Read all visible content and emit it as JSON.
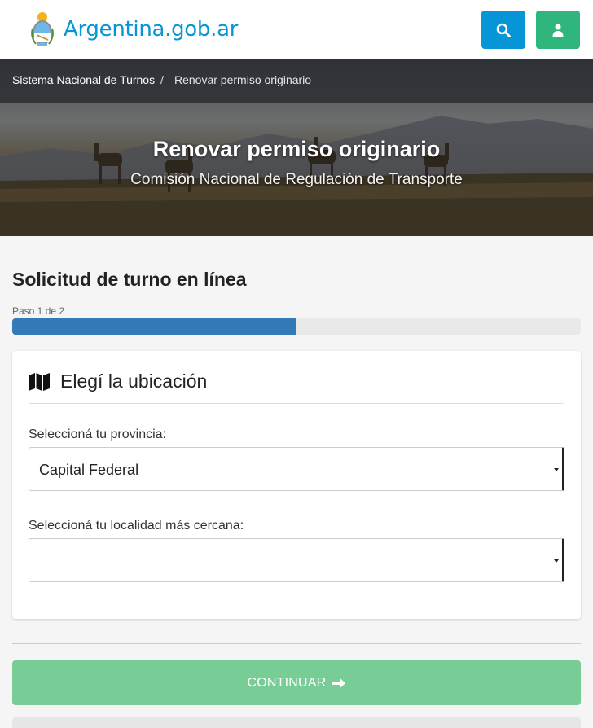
{
  "header": {
    "brand": "Argentina.gob.ar",
    "search_icon": "search-icon",
    "user_icon": "user-icon"
  },
  "breadcrumb": {
    "items": [
      "Sistema Nacional de Turnos",
      "Renovar permiso originario"
    ],
    "separator": "/"
  },
  "hero": {
    "title": "Renovar permiso originario",
    "subtitle": "Comisión Nacional de Regulación de Transporte"
  },
  "form": {
    "title": "Solicitud de turno en línea",
    "step_label": "Paso 1 de 2",
    "progress": 0.5,
    "section_icon": "map-icon",
    "section_title": "Elegí la ubicación",
    "province_label": "Seleccioná tu provincia:",
    "province_value": "Capital Federal",
    "locality_label": "Seleccioná tu localidad más cercana:",
    "locality_value": "",
    "continue_label": "CONTINUAR",
    "continue_icon": "arrow-right-icon"
  },
  "colors": {
    "brand": "#0695d6",
    "search_button": "#0695d6",
    "user_button": "#2eb67d",
    "progress_fill": "#337ab7",
    "continue_button": "#78cc96"
  }
}
